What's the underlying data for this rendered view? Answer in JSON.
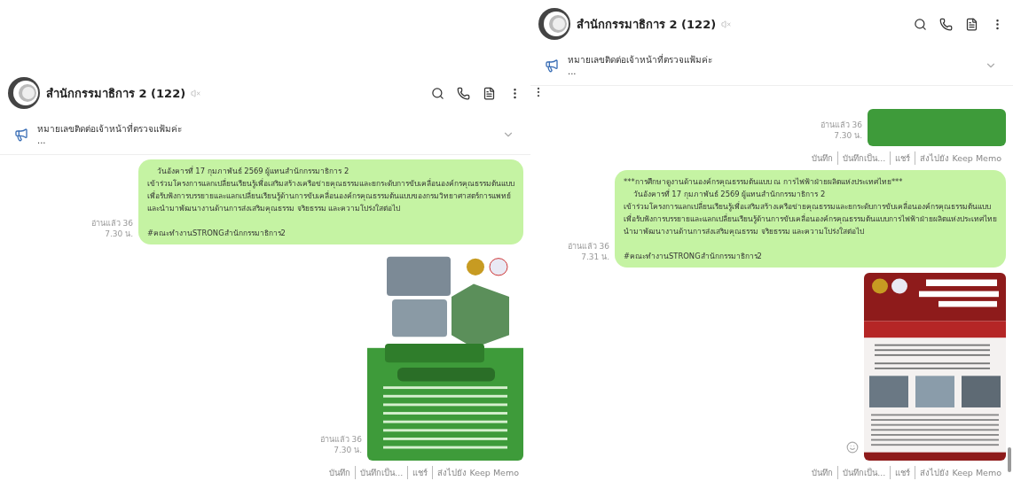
{
  "panels": [
    {
      "chat": {
        "title": "สำนักกรรมาธิการ 2 (122)",
        "muted": true
      },
      "announcement": {
        "text": "หมายเลขติดต่อเจ้าหน้าที่ตรวจแฟ้มค่ะ",
        "more": "..."
      },
      "messages": [
        {
          "kind": "text",
          "text": "    วันอังคารที่ 17 กุมภาพันธ์ 2569 ผู้แทนสำนักกรรมาธิการ 2\nเข้าร่วมโครงการแลกเปลี่ยนเรียนรู้เพื่อเสริมสร้างเครือข่ายคุณธรรมและยกระดับการขับเคลื่อนองค์กรคุณธรรมต้นแบบ\nเพื่อรับฟังการบรรยายและแลกเปลี่ยนเรียนรู้ด้านการขับเคลื่อนองค์กรคุณธรรมต้นแบบของกรมวิทยาศาสตร์การแพทย์\nและนำมาพัฒนางานด้านการส่งเสริมคุณธรรม จริยธรรม และความโปร่งใสต่อไป\n\n#คณะทำงานSTRONGสำนักกรรมาธิการ2",
          "read": "อ่านแล้ว 36",
          "time": "7.30 น."
        },
        {
          "kind": "flyer",
          "read": "อ่านแล้ว 36",
          "time": "7.30 น.",
          "actions": [
            "บันทึก",
            "บันทึกเป็น...",
            "แชร์",
            "ส่งไปยัง Keep Memo"
          ]
        }
      ]
    },
    {
      "chat": {
        "title": "สำนักกรรมาธิการ 2 (122)",
        "muted": true
      },
      "announcement": {
        "text": "หมายเลขติดต่อเจ้าหน้าที่ตรวจแฟ้มค่ะ",
        "more": "..."
      },
      "messages": [
        {
          "kind": "partial",
          "read": "อ่านแล้ว 36",
          "time": "7.30 น.",
          "actions": [
            "บันทึก",
            "บันทึกเป็น...",
            "แชร์",
            "ส่งไปยัง Keep Memo"
          ]
        },
        {
          "kind": "text",
          "text": "***การศึกษาดูงานด้านองค์กรคุณธรรมต้นแบบ ณ การไฟฟ้าฝ่ายผลิตแห่งประเทศไทย***\n    วันอังคารที่ 17 กุมภาพันธ์ 2569 ผู้แทนสำนักกรรมาธิการ 2\nเข้าร่วมโครงการแลกเปลี่ยนเรียนรู้เพื่อเสริมสร้างเครือข่ายคุณธรรมและยกระดับการขับเคลื่อนองค์กรคุณธรรมต้นแบบ\nเพื่อรับฟังการบรรยายและแลกเปลี่ยนเรียนรู้ด้านการขับเคลื่อนองค์กรคุณธรรมต้นแบบการไฟฟ้าฝ่ายผลิตแห่งประเทศไทย\nนำมาพัฒนางานด้านการส่งเสริมคุณธรรม จริยธรรม และความโปร่งใสต่อไป\n\n#คณะทำงานSTRONGสำนักกรรมาธิการ2",
          "read": "อ่านแล้ว 36",
          "time": "7.31 น."
        },
        {
          "kind": "newsletter",
          "actions": [
            "บันทึก",
            "บันทึกเป็น...",
            "แชร์",
            "ส่งไปยัง Keep Memo"
          ]
        }
      ]
    }
  ]
}
